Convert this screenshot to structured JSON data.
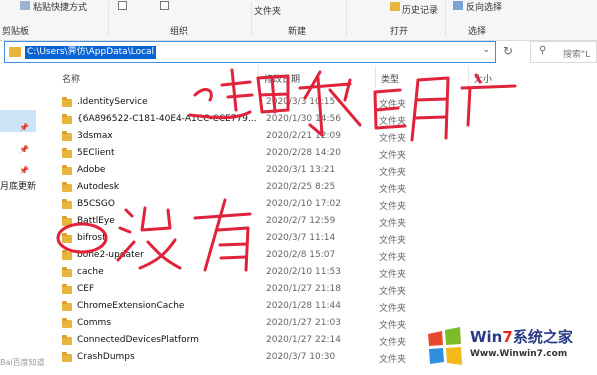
{
  "ribbon": {
    "paste_shortcut": "粘贴快捷方式",
    "clipboard_group": "剪贴板",
    "organize_group": "组织",
    "folder_label": "文件夹",
    "new_group": "新建",
    "history_label": "历史记录",
    "open_group": "打开",
    "invert_selection": "反向选择",
    "select_group": "选择"
  },
  "address": {
    "path": "C:\\Users\\霁仿\\AppData\\Local"
  },
  "search": {
    "placeholder": "搜索\"L"
  },
  "left_pane": {
    "text": "月底更新"
  },
  "columns": {
    "name": "名称",
    "date": "修改日期",
    "type": "类型",
    "size": "大小"
  },
  "files": [
    {
      "name": ".IdentityService",
      "date": "2020/3/3 10:15",
      "type": "文件夹"
    },
    {
      "name": "{6A896522-C181-40E4-A1CC-CCE779...",
      "date": "2020/1/30 14:56",
      "type": "文件夹"
    },
    {
      "name": "3dsmax",
      "date": "2020/2/21 12:09",
      "type": "文件夹"
    },
    {
      "name": "5EClient",
      "date": "2020/2/28 14:20",
      "type": "文件夹"
    },
    {
      "name": "Adobe",
      "date": "2020/3/1 13:21",
      "type": "文件夹"
    },
    {
      "name": "Autodesk",
      "date": "2020/2/25 8:25",
      "type": "文件夹"
    },
    {
      "name": "B5CSGO",
      "date": "2020/2/10 17:02",
      "type": "文件夹"
    },
    {
      "name": "BattlEye",
      "date": "2020/2/7 12:59",
      "type": "文件夹"
    },
    {
      "name": "bifrost",
      "date": "2020/3/7 11:14",
      "type": "文件夹"
    },
    {
      "name": "bohe2-updater",
      "date": "2020/2/8 15:07",
      "type": "文件夹"
    },
    {
      "name": "cache",
      "date": "2020/2/10 11:53",
      "type": "文件夹"
    },
    {
      "name": "CEF",
      "date": "2020/1/27 21:18",
      "type": "文件夹"
    },
    {
      "name": "ChromeExtensionCache",
      "date": "2020/1/28 11:44",
      "type": "文件夹"
    },
    {
      "name": "Comms",
      "date": "2020/1/27 21:03",
      "type": "文件夹"
    },
    {
      "name": "ConnectedDevicesPlatform",
      "date": "2020/1/27 22:14",
      "type": "文件夹"
    },
    {
      "name": "CrashDumps",
      "date": "2020/3/7 10:30",
      "type": "文件夹"
    }
  ],
  "watermark": {
    "left": "Bai百度知道",
    "brand_prefix": "Win",
    "brand_digit": "7",
    "brand_suffix": "系统之家",
    "url": "Www.Winwin7.com"
  },
  "colors": {
    "folder": "#e8b53c",
    "selection": "#0a64d6",
    "handwriting": "#e0223a"
  }
}
